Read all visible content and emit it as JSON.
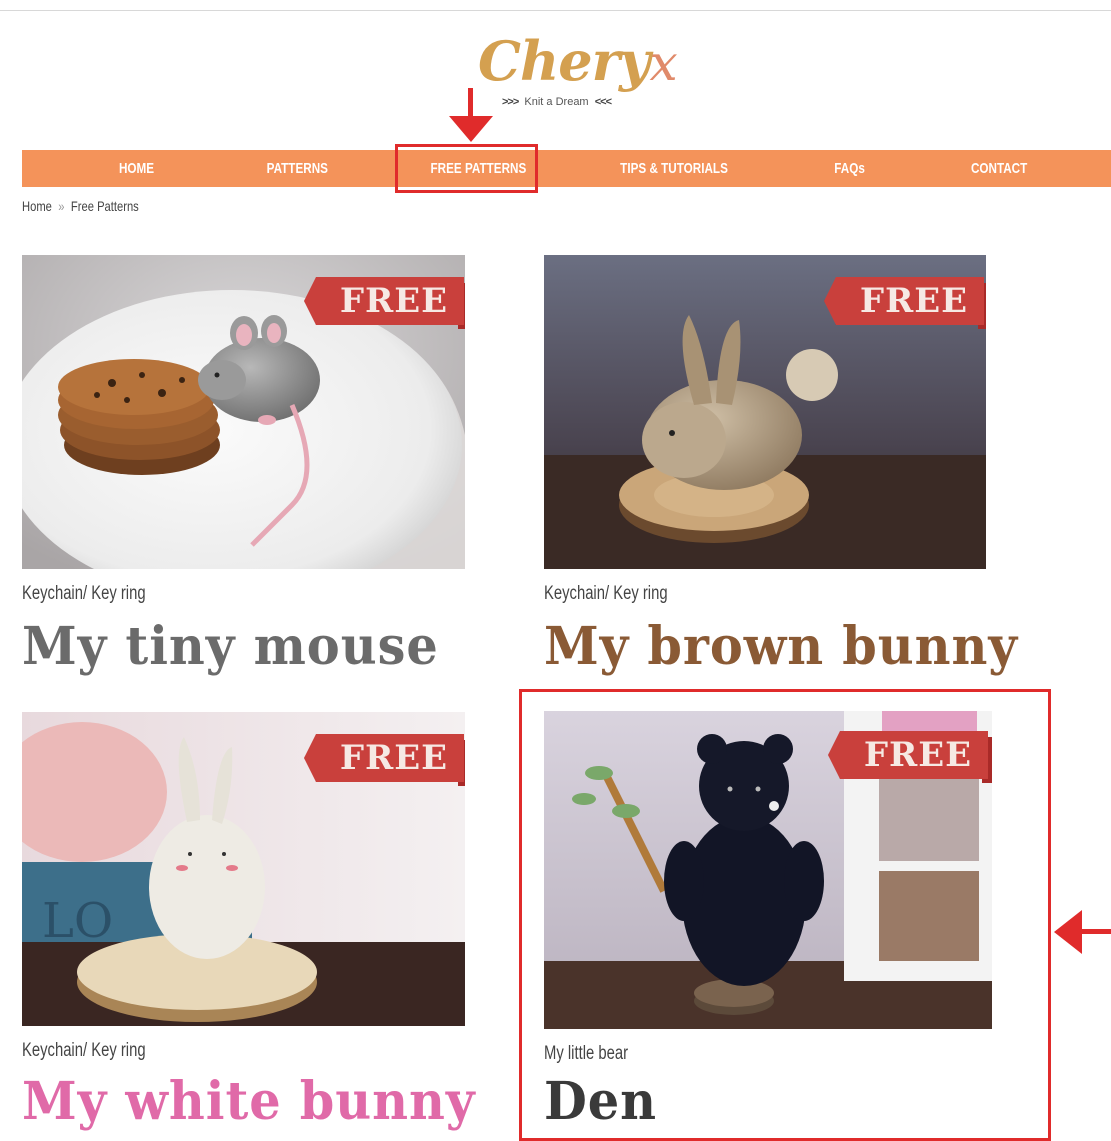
{
  "brand": {
    "name": "Chery",
    "name_suffix": "x",
    "tagline_left": ">>>",
    "tagline": "Knit a Dream",
    "tagline_right": "<<<"
  },
  "colors": {
    "nav_bg": "#f4935a",
    "annotation": "#e02b2b",
    "ribbon": "#c9403c",
    "logo": "#d4a050"
  },
  "nav": {
    "items": [
      "HOME",
      "PATTERNS",
      "FREE PATTERNS",
      "TIPS & TUTORIALS",
      "FAQs",
      "CONTACT"
    ]
  },
  "breadcrumb": {
    "home": "Home",
    "separator": "»",
    "current": "Free Patterns"
  },
  "cards": [
    {
      "badge": "FREE",
      "category": "Keychain/ Key ring",
      "title": "My tiny mouse",
      "title_color": "#6b6b6b",
      "image": "knitted-mouse-photo"
    },
    {
      "badge": "FREE",
      "category": "Keychain/ Key ring",
      "title": "My brown bunny",
      "title_color": "#8a5a35",
      "image": "knitted-brown-bunny-photo"
    },
    {
      "badge": "FREE",
      "category": "Keychain/ Key ring",
      "title": "My white bunny",
      "title_color": "#e06aa8",
      "image": "knitted-white-bunny-photo"
    },
    {
      "badge": "FREE",
      "category": "My little bear",
      "title": "Den",
      "title_color": "#3a3a3a",
      "image": "knitted-black-bear-photo"
    }
  ]
}
